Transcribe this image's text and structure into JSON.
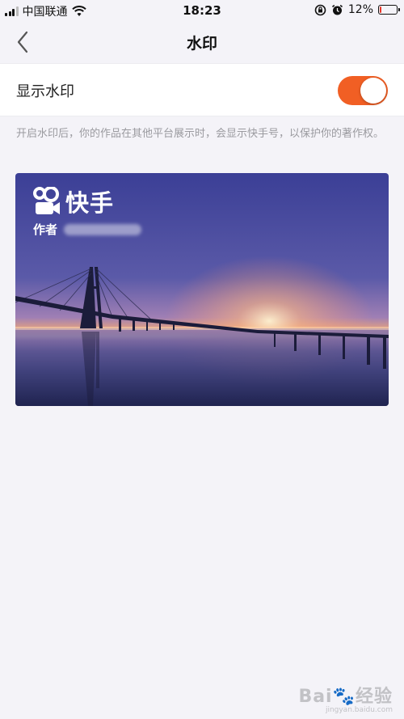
{
  "status_bar": {
    "carrier": "中国联通",
    "time": "18:23",
    "battery_percent": "12%",
    "battery_level": 0.12,
    "icons": [
      "signal-icon",
      "wifi-icon",
      "lock-rotation-icon",
      "alarm-icon",
      "battery-icon"
    ]
  },
  "nav": {
    "title": "水印",
    "back_icon": "chevron-left-icon"
  },
  "settings": {
    "watermark_label": "显示水印",
    "watermark_enabled": true,
    "hint": "开启水印后，你的作品在其他平台展示时，会显示快手号，以保护你的著作权。"
  },
  "preview": {
    "brand": "快手",
    "author_label": "作者"
  },
  "footer_watermark": {
    "line1": "Bai🐾经验",
    "line2": "jingyan.baidu.com"
  },
  "colors": {
    "accent": "#f15f24",
    "background": "#f4f3f8",
    "hint_text": "#9a9a9f"
  }
}
